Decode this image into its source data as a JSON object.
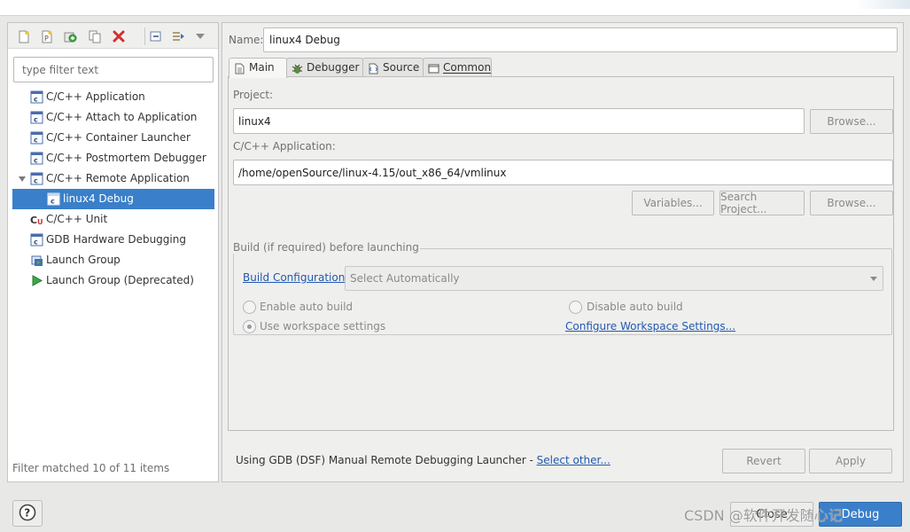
{
  "toolbar_left": {
    "buttons": [
      {
        "name": "new-configuration-icon"
      },
      {
        "name": "new-prototype-icon"
      },
      {
        "name": "export-icon"
      },
      {
        "name": "duplicate-icon"
      },
      {
        "name": "delete-icon"
      },
      {
        "name": "collapse-all-icon"
      },
      {
        "name": "filter-configurations-icon"
      },
      {
        "name": "view-menu-icon"
      }
    ]
  },
  "filter": {
    "placeholder": "type filter text",
    "value": ""
  },
  "tree": {
    "items": [
      {
        "label": "C/C++ Application",
        "icon": "c-app-icon",
        "depth": 0
      },
      {
        "label": "C/C++ Attach to Application",
        "icon": "c-app-icon",
        "depth": 0
      },
      {
        "label": "C/C++ Container Launcher",
        "icon": "c-app-icon",
        "depth": 0
      },
      {
        "label": "C/C++ Postmortem Debugger",
        "icon": "c-app-icon",
        "depth": 0
      },
      {
        "label": "C/C++ Remote Application",
        "icon": "c-app-icon",
        "depth": 0,
        "expanded": true
      },
      {
        "label": "linux4 Debug",
        "icon": "c-app-icon",
        "depth": 1,
        "selected": true
      },
      {
        "label": "C/C++ Unit",
        "icon": "c-unit-icon",
        "depth": 0
      },
      {
        "label": "GDB Hardware Debugging",
        "icon": "c-app-icon",
        "depth": 0
      },
      {
        "label": "Launch Group",
        "icon": "launch-group-icon",
        "depth": 0
      },
      {
        "label": "Launch Group (Deprecated)",
        "icon": "run-icon",
        "depth": 0
      }
    ]
  },
  "filter_status": "Filter matched 10 of 11 items",
  "config": {
    "name_label": "Name:",
    "name_value": "linux4 Debug",
    "tabs": [
      {
        "label": "Main",
        "icon": "main-tab-icon",
        "active": true
      },
      {
        "label": "Debugger",
        "icon": "debugger-tab-icon"
      },
      {
        "label": "Source",
        "icon": "source-tab-icon"
      },
      {
        "label": "Common",
        "icon": "common-tab-icon"
      }
    ],
    "project_label": "Project:",
    "project_value": "linux4",
    "browse_label": "Browse...",
    "app_label": "C/C++ Application:",
    "app_value": "/home/openSource/linux-4.15/out_x86_64/vmlinux",
    "variables_label": "Variables...",
    "search_project_label": "Search Project...",
    "browse2_label": "Browse...",
    "build_group_title": "Build (if required) before launching",
    "build_config_link": "Build Configuration:",
    "build_config_value": "Select Automatically",
    "enable_auto_build": "Enable auto build",
    "disable_auto_build": "Disable auto build",
    "use_workspace": "Use workspace settings",
    "configure_workspace_link": "Configure Workspace Settings...",
    "launcher_text": "Using GDB (DSF) Manual Remote Debugging Launcher - ",
    "select_other_link": "Select other...",
    "revert_label": "Revert",
    "apply_label": "Apply"
  },
  "bottom": {
    "help_icon": "help-icon",
    "close_label": "Close",
    "debug_label": "Debug"
  },
  "watermark": "CSDN @软件开发随心记"
}
